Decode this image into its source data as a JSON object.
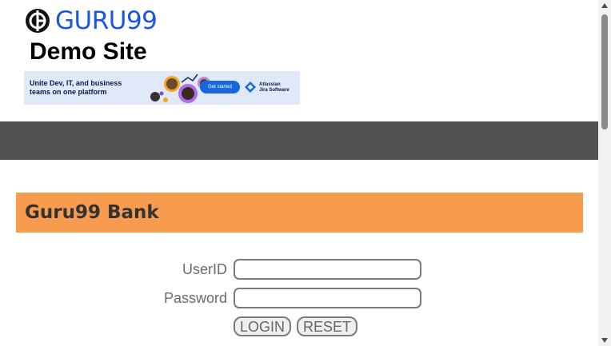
{
  "header": {
    "logo_text": "GURU99",
    "site_title": "Demo Site"
  },
  "ad": {
    "headline": "Unite Dev, IT, and business teams on one platform",
    "cta_label": "Get started",
    "brand_line1": "Atlassian",
    "brand_line2": "Jira Software"
  },
  "bank": {
    "title": "Guru99 Bank"
  },
  "login_form": {
    "userid_label": "UserID",
    "userid_value": "",
    "password_label": "Password",
    "password_value": "",
    "login_label": "LOGIN",
    "reset_label": "RESET"
  },
  "colors": {
    "logo_blue": "#1a56e0",
    "nav_bar": "#515151",
    "bank_bar": "#f79b4f",
    "ad_background": "#dfe9f8",
    "ad_button": "#1868db"
  }
}
